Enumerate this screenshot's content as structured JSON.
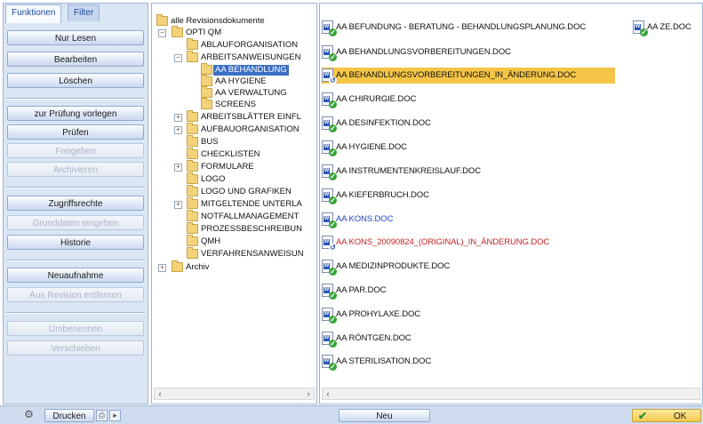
{
  "tabs": {
    "functions": "Funktionen",
    "filter": "Filter"
  },
  "left_buttons": {
    "read_only": "Nur Lesen",
    "edit": "Bearbeiten",
    "delete": "Löschen",
    "submit_review": "zur Prüfung vorlegen",
    "review": "Prüfen",
    "release": "Freigeben",
    "archive": "Archivieren",
    "access_rights": "Zugriffsrechte",
    "enter_master_data": "Grunddaten eingeben",
    "history": "Historie",
    "new_record": "Neuaufnahme",
    "remove_from_revision": "Aus Revision entfernen",
    "rename": "Umbenennen",
    "move": "Verschieben"
  },
  "tree": {
    "root": "alle Revisionsdokumente",
    "items": [
      "OPTI QM",
      "ABLAUFORGANISATION",
      "ARBEITSANWEISUNGEN",
      "AA BEHANDLUNG",
      "AA HYGIENE",
      "AA VERWALTUNG",
      "SCREENS",
      "ARBEITSBLÄTTER EINFL",
      "AUFBAUORGANISATION",
      "BUS",
      "CHECKLISTEN",
      "FORMULARE",
      "LOGO",
      "LOGO UND GRAFIKEN",
      "MITGELTENDE UNTERLA",
      "NOTFALLMANAGEMENT",
      "PROZESSBESCHREIBUN",
      "QMH",
      "VERFAHRENSANWEISUN",
      "Archiv"
    ]
  },
  "files": [
    {
      "name": "AA BEFUNDUNG - BERATUNG - BEHANDLUNGSPLANUNG.DOC",
      "status": "ok",
      "style": "normal"
    },
    {
      "name": "AA BEHANDLUNGSVORBEREITUNGEN.DOC",
      "status": "ok",
      "style": "normal"
    },
    {
      "name": "AA BEHANDLUNGSVORBEREITUNGEN_IN_ÄNDERUNG.DOC",
      "status": "edit",
      "style": "highlight"
    },
    {
      "name": "AA CHIRURGIE.DOC",
      "status": "ok",
      "style": "normal"
    },
    {
      "name": "AA DESINFEKTION.DOC",
      "status": "ok",
      "style": "normal"
    },
    {
      "name": "AA HYGIENE.DOC",
      "status": "ok",
      "style": "normal"
    },
    {
      "name": "AA INSTRUMENTENKREISLAUF.DOC",
      "status": "ok",
      "style": "normal"
    },
    {
      "name": "AA KIEFERBRUCH.DOC",
      "status": "ok",
      "style": "normal"
    },
    {
      "name": "AA KONS.DOC",
      "status": "ok",
      "style": "blue"
    },
    {
      "name": "AA KONS_20090824_(ORIGINAL)_IN_ÄNDERUNG.DOC",
      "status": "edit",
      "style": "red"
    },
    {
      "name": "AA MEDIZINPRODUKTE.DOC",
      "status": "ok",
      "style": "normal"
    },
    {
      "name": "AA PAR.DOC",
      "status": "ok",
      "style": "normal"
    },
    {
      "name": "AA PROHYLAXE.DOC",
      "status": "ok",
      "style": "normal"
    },
    {
      "name": "AA RÖNTGEN.DOC",
      "status": "ok",
      "style": "normal"
    },
    {
      "name": "AA STERILISATION.DOC",
      "status": "ok",
      "style": "normal"
    }
  ],
  "files_extra": {
    "name": "AA ZE.DOC",
    "status": "ok"
  },
  "bottom": {
    "print": "Drucken",
    "new": "Neu",
    "ok": "OK"
  },
  "icons": {
    "word_doc": "word-document-icon",
    "approved": "checkmark-badge-icon",
    "in_edit": "undo-arrow-badge-icon",
    "folder": "folder-icon"
  },
  "colors": {
    "highlight": "#f5c547",
    "selected_tree": "#3b6fc4",
    "blue_file": "#2346c9",
    "red_file": "#c42222",
    "approved_badge": "#3aa33a"
  }
}
